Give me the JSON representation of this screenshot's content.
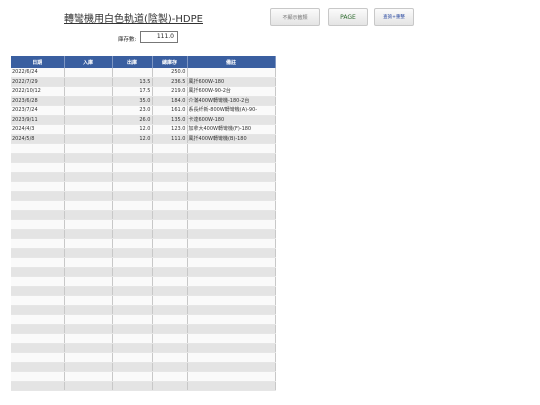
{
  "title": "轉彎機用白色軌道(陰製)-HDPE",
  "buttons": {
    "left": "不顯示籤類",
    "page": "PAGE",
    "sort": "查詢+重整"
  },
  "stock": {
    "label": "庫存數:",
    "value": "111.0"
  },
  "table": {
    "headers": [
      "日期",
      "入庫",
      "出庫",
      "總庫存",
      "備註"
    ],
    "rows": [
      [
        "2022/6/24",
        "",
        "",
        "250.0",
        ""
      ],
      [
        "2022/7/29",
        "",
        "13.5",
        "236.5",
        "風扦600W-180"
      ],
      [
        "2022/10/12",
        "",
        "17.5",
        "219.0",
        "風扦600W-90-2台"
      ],
      [
        "2023/6/28",
        "",
        "35.0",
        "184.0",
        "介滿400W轉彎機-180-2台"
      ],
      [
        "2023/7/24",
        "",
        "23.0",
        "161.0",
        "系長纤新-800W轉彎機(A)-90-"
      ],
      [
        "2023/9/11",
        "",
        "26.0",
        "135.0",
        "卡達600W-180"
      ],
      [
        "2024/4/3",
        "",
        "12.0",
        "123.0",
        "加拿大400W轉彎機(F)-180"
      ],
      [
        "2024/5/8",
        "",
        "12.0",
        "111.0",
        "風扦400W轉彎機(B)-180"
      ]
    ],
    "empty_rows": 26
  }
}
